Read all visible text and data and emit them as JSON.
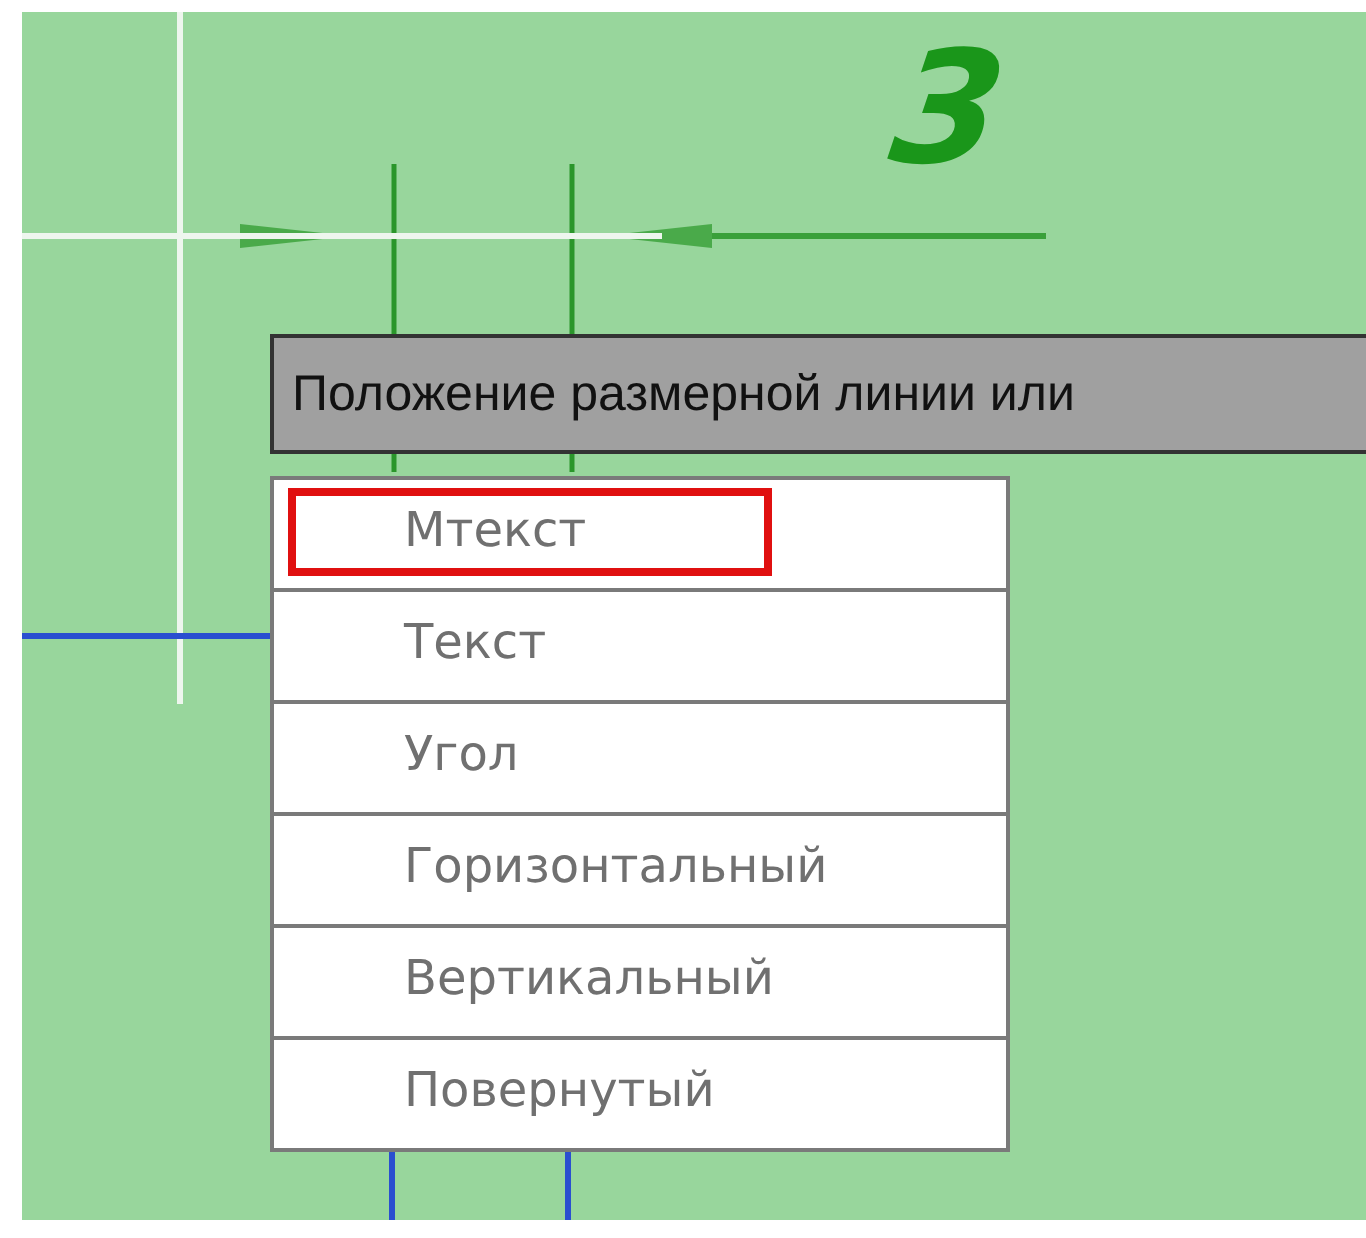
{
  "drawing": {
    "dimension_text": "3"
  },
  "prompt": {
    "text": "Положение размерной линии или"
  },
  "options": [
    {
      "label": "Мтекст",
      "highlighted": true
    },
    {
      "label": "Текст",
      "highlighted": false
    },
    {
      "label": "Угол",
      "highlighted": false
    },
    {
      "label": "Горизонтальный",
      "highlighted": false
    },
    {
      "label": "Вертикальный",
      "highlighted": false
    },
    {
      "label": "Повернутый",
      "highlighted": false
    }
  ]
}
